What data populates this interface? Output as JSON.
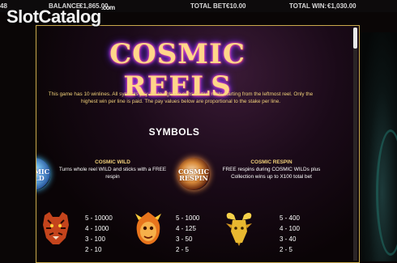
{
  "top_bar": {
    "left_fragment": "48",
    "balance_label": "BALANCE",
    "balance_value": "€1,865.00",
    "total_bet_label": "TOTAL BET",
    "total_bet_value": "€10.00",
    "total_win_label": "TOTAL WIN:",
    "total_win_value": "€1,030.00"
  },
  "watermark": {
    "text": "SlotCatalog",
    "suffix": ".com"
  },
  "logo": {
    "text": "COSMIC REELS"
  },
  "description": "This game has 10 winlines. All symbols pay left to right on consecutive reels starting from the leftmost reel. Only the highest win per line is paid. The pay values below are proportional to the stake per line.",
  "symbols_heading": "SYMBOLS",
  "specials": [
    {
      "icon": "cosmic-wild-icon",
      "icon_text": "COSMIC WILD",
      "title": "COSMIC WILD",
      "text": "Turns whole reel WILD and sticks with a FREE respin"
    },
    {
      "icon": "cosmic-respin-icon",
      "icon_text": "COSMIC RESPIN",
      "title": "COSMIC RESPIN",
      "text": "FREE respins during COSMIC WILDs plus Collection wins up to X100 total bet"
    }
  ],
  "paytable": [
    {
      "icon": "tiger-icon",
      "pays": [
        "5 - 10000",
        "4 - 1000",
        "3 - 100",
        "2 - 10"
      ]
    },
    {
      "icon": "fire-monkey-icon",
      "pays": [
        "5 - 1000",
        "4 - 125",
        "3 - 50",
        "2 - 5"
      ]
    },
    {
      "icon": "goat-icon",
      "pays": [
        "5 - 400",
        "4 - 100",
        "3 - 40",
        "2 - 5"
      ]
    }
  ],
  "colors": {
    "accent_gold": "#f2d27a",
    "panel_border": "#c9a94c",
    "background": "#0a0606"
  }
}
